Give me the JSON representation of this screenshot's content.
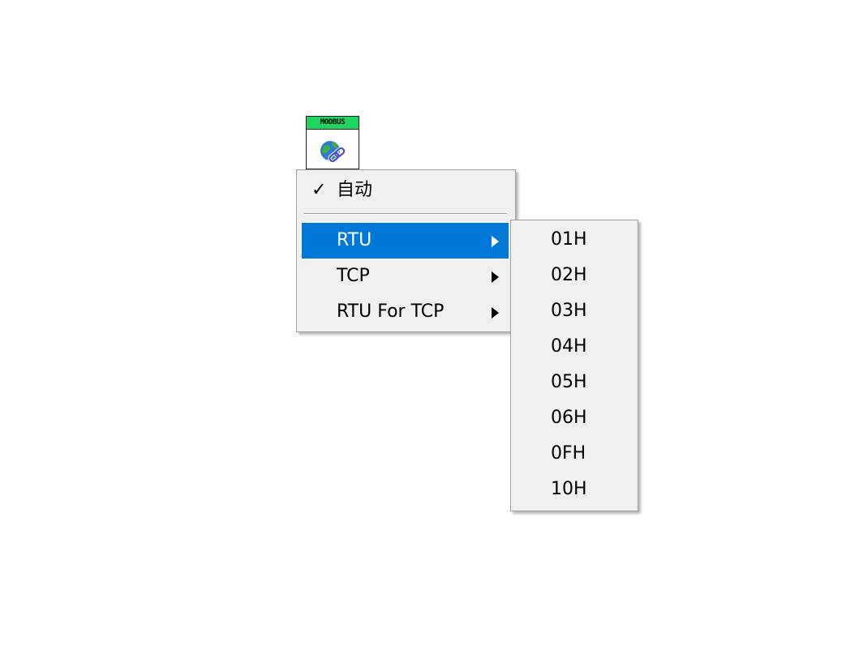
{
  "node": {
    "label": "MODBUS",
    "label_color": "#1fd55f",
    "icon": "globe-link-icon"
  },
  "menu": {
    "items": [
      {
        "label": "自动",
        "checked": true,
        "check_mark": "✓"
      },
      {
        "label": "RTU",
        "has_submenu": true,
        "selected": true
      },
      {
        "label": "TCP",
        "has_submenu": true
      },
      {
        "label": "RTU For TCP",
        "has_submenu": true
      }
    ],
    "highlight_color": "#0078d7"
  },
  "submenu": {
    "items": [
      "01H",
      "02H",
      "03H",
      "04H",
      "05H",
      "06H",
      "0FH",
      "10H"
    ]
  }
}
